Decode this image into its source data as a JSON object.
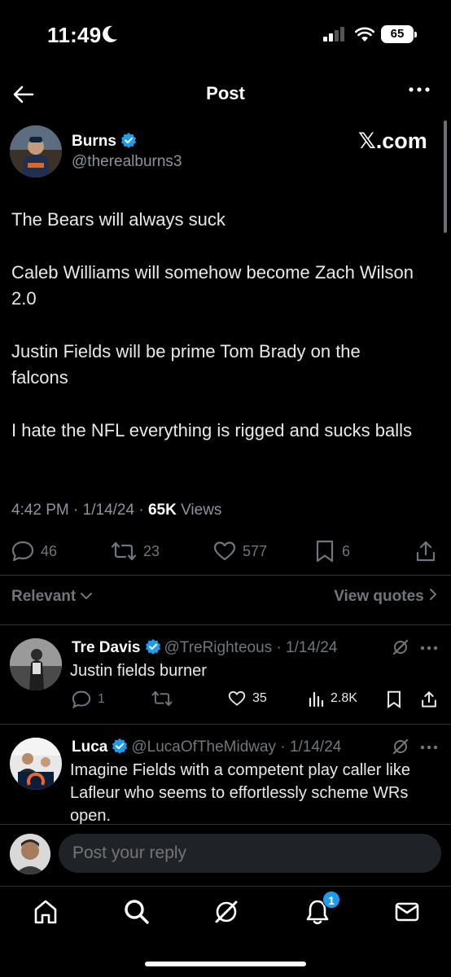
{
  "status_bar": {
    "time": "11:49",
    "battery": "65"
  },
  "header": {
    "title": "Post"
  },
  "post": {
    "author_name": "Burns",
    "author_handle": "@therealburns3",
    "watermark": "𝕏.com",
    "paragraphs": [
      "The Bears will always suck",
      "Caleb Williams will somehow become Zach Wilson 2.0",
      "Justin Fields will be prime Tom Brady on the falcons",
      "I hate the NFL everything is rigged and sucks balls"
    ],
    "time": "4:42 PM",
    "date": "1/14/24",
    "views_count": "65K",
    "views_label": "Views",
    "replies": "46",
    "reposts": "23",
    "likes": "577",
    "bookmarks": "6"
  },
  "sort": {
    "label": "Relevant",
    "view_quotes": "View quotes"
  },
  "replies": [
    {
      "name": "Tre Davis",
      "handle": "@TreRighteous",
      "date": "1/14/24",
      "text": "Justin fields burner",
      "replies": "1",
      "likes": "35",
      "views": "2.8K"
    },
    {
      "name": "Luca",
      "handle": "@LucaOfTheMidway",
      "date": "1/14/24",
      "text": "Imagine Fields with a competent play caller like Lafleur who seems to effortlessly scheme WRs open."
    }
  ],
  "composer": {
    "placeholder": "Post your reply"
  },
  "tabbar": {
    "notification_count": "1"
  },
  "colors": {
    "accent": "#1d9bf0",
    "muted": "#71767b",
    "background": "#000000"
  }
}
